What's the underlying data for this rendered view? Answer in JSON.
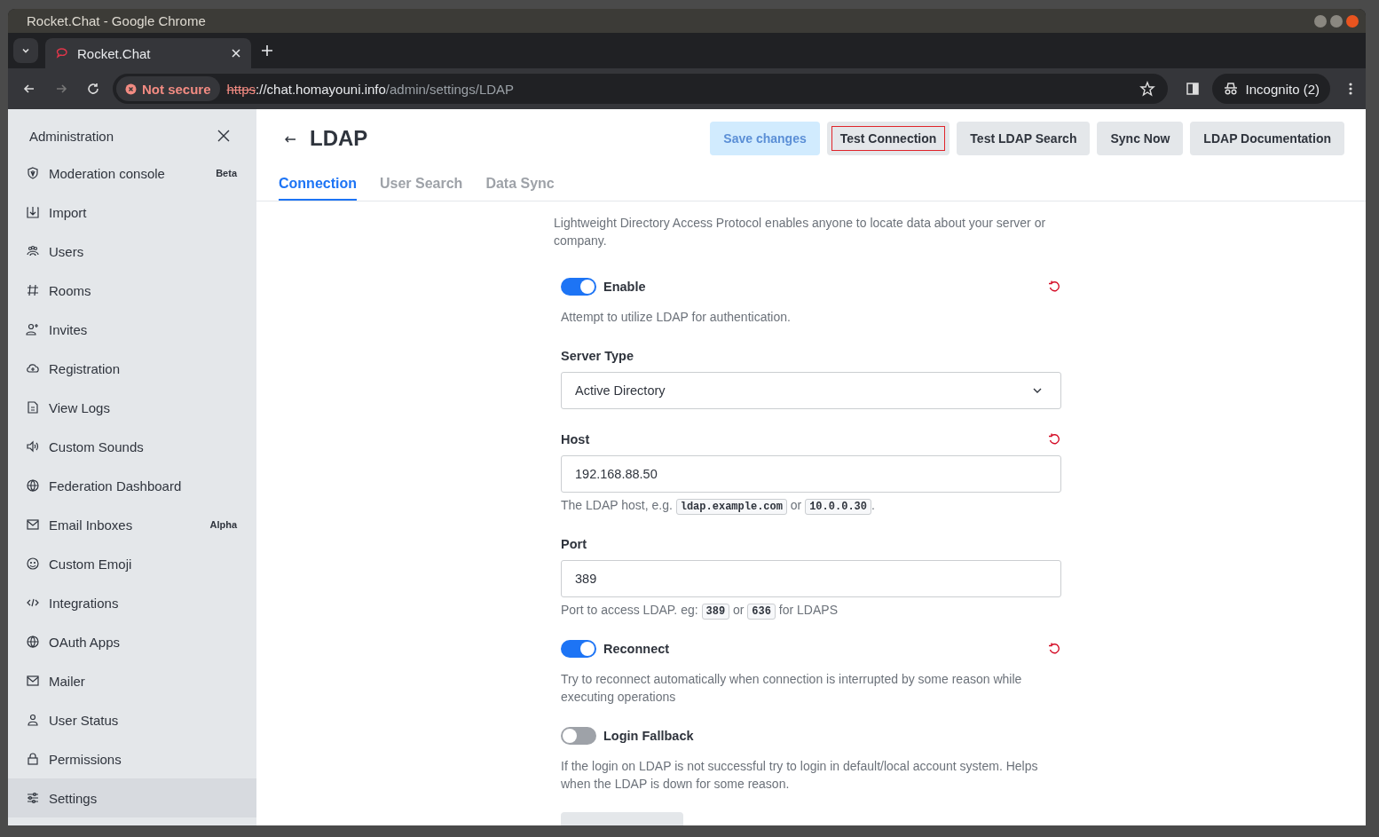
{
  "window": {
    "title": "Rocket.Chat - Google Chrome"
  },
  "browser": {
    "tabs": [
      {
        "title": "Rocket.Chat",
        "selected": true
      }
    ],
    "security": "Not secure",
    "url": {
      "scheme": "https",
      "host": "://chat.homayouni.info",
      "path": "/admin/settings/LDAP"
    },
    "profile": "Incognito (2)"
  },
  "sidebar": {
    "title": "Administration",
    "items": [
      {
        "label": "Moderation console",
        "badge": "Beta",
        "selected": false
      },
      {
        "label": "Import",
        "selected": false
      },
      {
        "label": "Users",
        "selected": false
      },
      {
        "label": "Rooms",
        "selected": false
      },
      {
        "label": "Invites",
        "selected": false
      },
      {
        "label": "Registration",
        "selected": false
      },
      {
        "label": "View Logs",
        "selected": false
      },
      {
        "label": "Custom Sounds",
        "selected": false
      },
      {
        "label": "Federation Dashboard",
        "selected": false
      },
      {
        "label": "Email Inboxes",
        "badge": "Alpha",
        "selected": false
      },
      {
        "label": "Custom Emoji",
        "selected": false
      },
      {
        "label": "Integrations",
        "selected": false
      },
      {
        "label": "OAuth Apps",
        "selected": false
      },
      {
        "label": "Mailer",
        "selected": false
      },
      {
        "label": "User Status",
        "selected": false
      },
      {
        "label": "Permissions",
        "selected": false
      },
      {
        "label": "Settings",
        "selected": true
      }
    ]
  },
  "header": {
    "title": "LDAP",
    "buttons": [
      {
        "label": "Save changes",
        "kind": "primary",
        "disabled": true,
        "focused": false
      },
      {
        "label": "Test Connection",
        "kind": "secondary",
        "disabled": false,
        "focused": true
      },
      {
        "label": "Test LDAP Search",
        "kind": "secondary",
        "disabled": false,
        "focused": false
      },
      {
        "label": "Sync Now",
        "kind": "secondary",
        "disabled": false,
        "focused": false
      },
      {
        "label": "LDAP Documentation",
        "kind": "secondary",
        "disabled": false,
        "focused": false
      }
    ]
  },
  "tabs": [
    {
      "label": "Connection",
      "selected": true
    },
    {
      "label": "User Search",
      "selected": false
    },
    {
      "label": "Data Sync",
      "selected": false
    }
  ],
  "description": "Lightweight Directory Access Protocol enables anyone to locate data about your server or company.",
  "fields": [
    {
      "kind": "toggle",
      "label": "Enable",
      "on": true,
      "resettable": true,
      "hint": [
        {
          "kind": "text",
          "text": "Attempt to utilize LDAP for authentication."
        }
      ]
    },
    {
      "kind": "select",
      "label": "Server Type",
      "value": "Active Directory",
      "resettable": false
    },
    {
      "kind": "text",
      "label": "Host",
      "value": "192.168.88.50",
      "resettable": true,
      "hint": [
        {
          "kind": "text",
          "text": "The LDAP host, e.g. "
        },
        {
          "kind": "code",
          "text": "ldap.example.com"
        },
        {
          "kind": "text",
          "text": " or "
        },
        {
          "kind": "code",
          "text": "10.0.0.30"
        },
        {
          "kind": "text",
          "text": "."
        }
      ]
    },
    {
      "kind": "text",
      "label": "Port",
      "value": "389",
      "resettable": false,
      "hint": [
        {
          "kind": "text",
          "text": "Port to access LDAP. eg: "
        },
        {
          "kind": "code",
          "text": "389"
        },
        {
          "kind": "text",
          "text": " or "
        },
        {
          "kind": "code",
          "text": "636"
        },
        {
          "kind": "text",
          "text": " for LDAPS"
        }
      ]
    },
    {
      "kind": "toggle",
      "label": "Reconnect",
      "on": true,
      "resettable": true,
      "hint": [
        {
          "kind": "text",
          "text": "Try to reconnect automatically when connection is interrupted by some reason while executing operations"
        }
      ]
    },
    {
      "kind": "toggle",
      "label": "Login Fallback",
      "on": false,
      "resettable": false,
      "hint": [
        {
          "kind": "text",
          "text": "If the login on LDAP is not successful try to login in default/local account system. Helps when the LDAP is down for some reason."
        }
      ]
    }
  ]
}
